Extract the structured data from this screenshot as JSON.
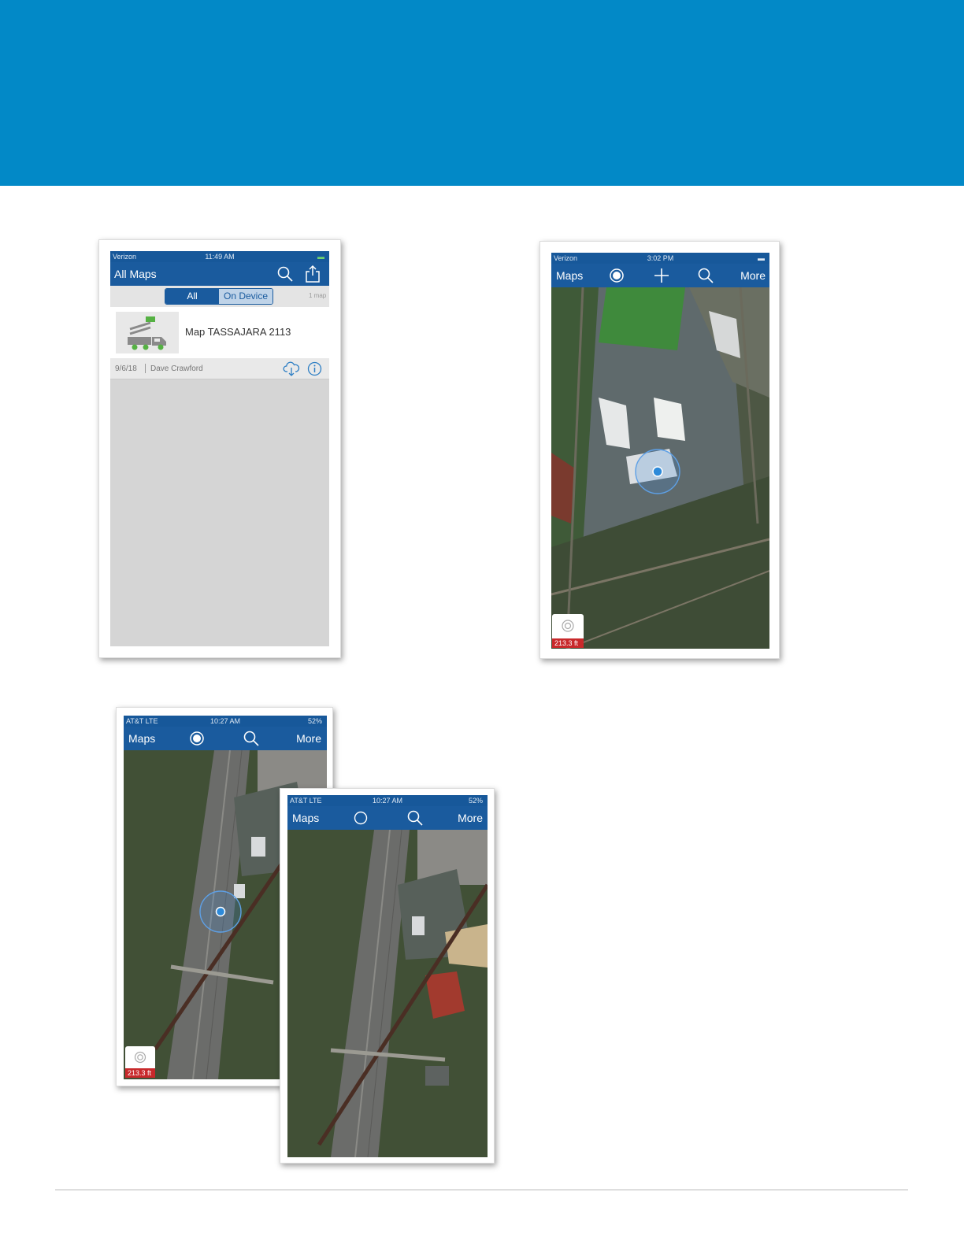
{
  "header": {
    "color": "#0289c7"
  },
  "screenshot1": {
    "status": {
      "carrier": "Verizon",
      "time": "11:49 AM"
    },
    "title": "All Maps",
    "search_icon": "search-icon",
    "share_icon": "share-icon",
    "segment": {
      "all": "All",
      "on_device": "On Device",
      "selected": "All"
    },
    "count_text": "1 map",
    "item": {
      "title": "Map TASSAJARA 2113",
      "thumbnail_icon": "bucket-truck-icon",
      "date": "9/6/18",
      "author": "Dave Crawford",
      "download_icon": "cloud-download-icon",
      "info_icon": "info-icon"
    }
  },
  "screenshot2": {
    "status": {
      "carrier": "Verizon",
      "time": "3:02 PM"
    },
    "nav": {
      "maps": "Maps",
      "more": "More"
    },
    "icons": [
      "location-icon",
      "plus-icon",
      "search-icon"
    ],
    "accuracy": "213.3 ft"
  },
  "screenshot3": {
    "status": {
      "carrier": "AT&T  LTE",
      "time": "10:27 AM",
      "battery": "52%"
    },
    "nav": {
      "maps": "Maps",
      "more": "More"
    },
    "location_mode": "active",
    "accuracy": "213.3 ft"
  },
  "screenshot4": {
    "status": {
      "carrier": "AT&T  LTE",
      "time": "10:27 AM",
      "battery": "52%"
    },
    "nav": {
      "maps": "Maps",
      "more": "More"
    },
    "location_mode": "off"
  },
  "colors": {
    "nav_bar": "#1a5b9e",
    "accuracy_badge": "#c8292b",
    "location_dot": "#2d8ad9"
  }
}
